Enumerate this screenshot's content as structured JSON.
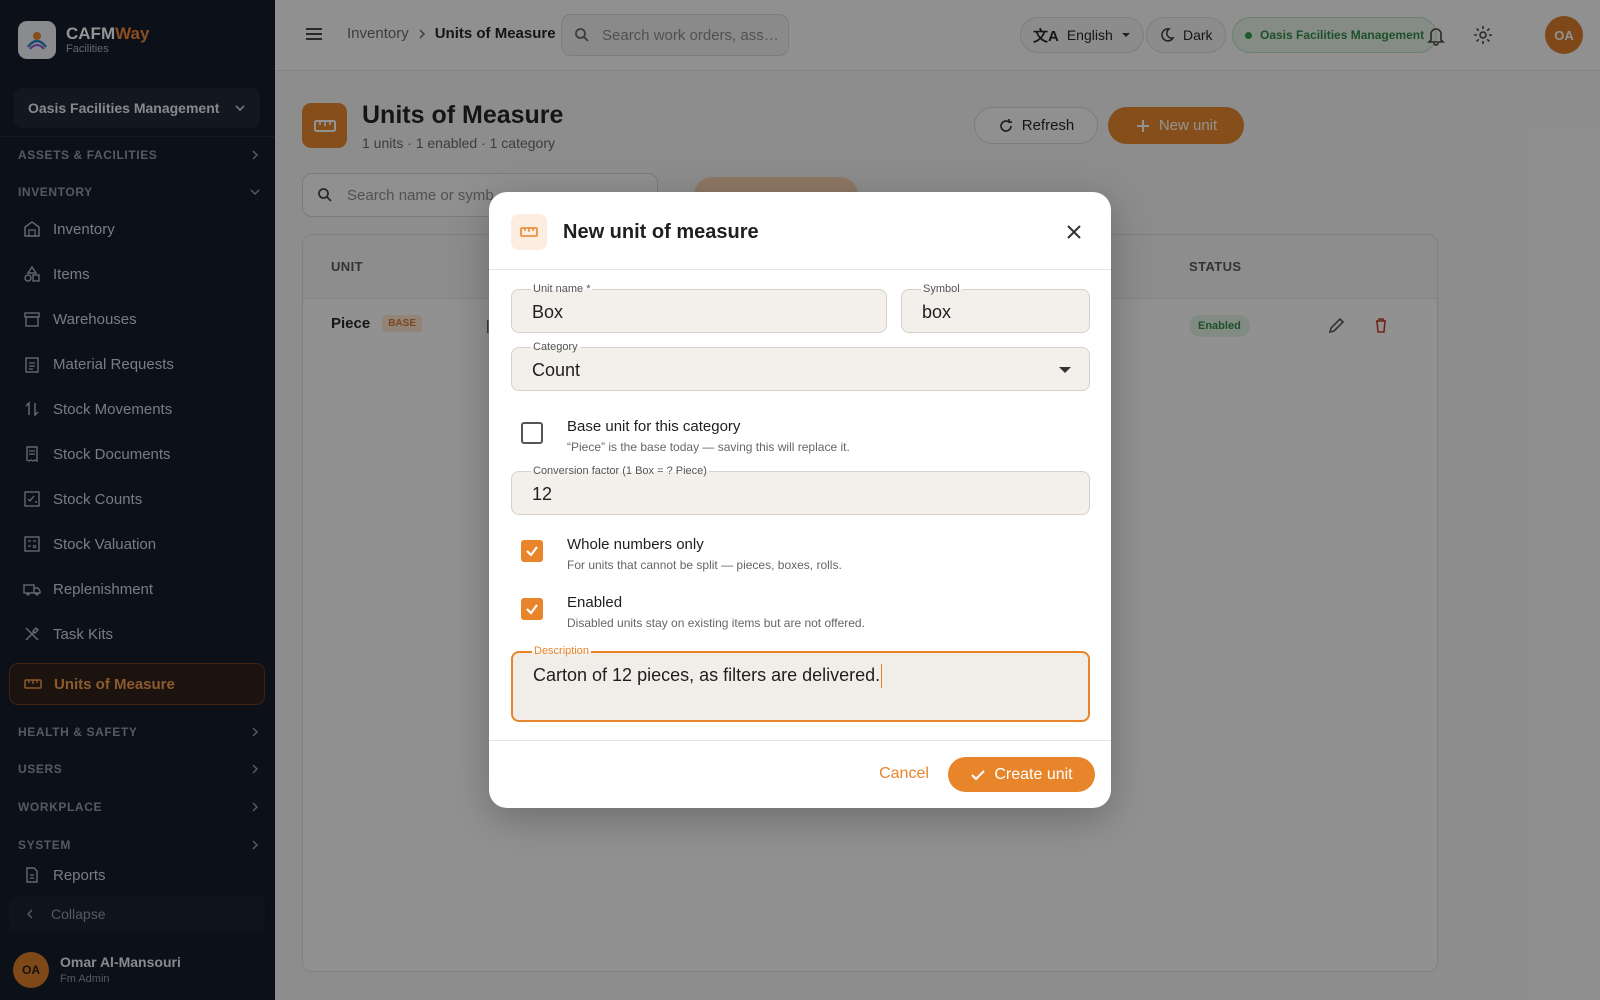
{
  "brand": {
    "name_part1": "CAFM",
    "name_part2": "Way",
    "subtitle": "Facilities"
  },
  "sidebar": {
    "org_select": "Oasis Facilities Management",
    "sections": {
      "assets": "ASSETS & FACILITIES",
      "inventory": "INVENTORY",
      "health": "HEALTH & SAFETY",
      "users": "USERS",
      "workplace": "WORKPLACE",
      "system": "SYSTEM"
    },
    "items": [
      {
        "label": "Inventory",
        "icon": "warehouse-icon"
      },
      {
        "label": "Items",
        "icon": "shapes-icon"
      },
      {
        "label": "Warehouses",
        "icon": "store-icon"
      },
      {
        "label": "Material Requests",
        "icon": "clipboard-icon"
      },
      {
        "label": "Stock Movements",
        "icon": "swap-vertical-icon"
      },
      {
        "label": "Stock Documents",
        "icon": "receipt-icon"
      },
      {
        "label": "Stock Counts",
        "icon": "checklist-icon"
      },
      {
        "label": "Stock Valuation",
        "icon": "calculator-icon"
      },
      {
        "label": "Replenishment",
        "icon": "truck-icon"
      },
      {
        "label": "Task Kits",
        "icon": "tools-icon"
      },
      {
        "label": "Units of Measure",
        "icon": "ruler-icon",
        "active": true
      }
    ],
    "reports": "Reports",
    "collapse": "Collapse",
    "user": {
      "initials": "OA",
      "name": "Omar Al-Mansouri",
      "role": "Fm Admin"
    }
  },
  "topbar": {
    "breadcrumb_parent": "Inventory",
    "breadcrumb_current": "Units of Measure",
    "search_placeholder": "Search work orders, ass…",
    "language": "English",
    "theme": "Dark",
    "org": "Oasis Facilities Management",
    "avatar": "OA"
  },
  "page": {
    "title": "Units of Measure",
    "subtitle": "1 units · 1 enabled · 1 category",
    "refresh_label": "Refresh",
    "new_label": "New unit",
    "search_placeholder": "Search name or symb",
    "columns": {
      "unit": "UNIT",
      "status": "STATUS"
    },
    "rows": [
      {
        "unit": "Piece",
        "base_badge": "BASE",
        "status": "Enabled"
      }
    ]
  },
  "modal": {
    "title": "New unit of measure",
    "unit_name_label": "Unit name *",
    "unit_name_value": "Box",
    "symbol_label": "Symbol",
    "symbol_value": "box",
    "category_label": "Category",
    "category_value": "Count",
    "base_unit_label": "Base unit for this category",
    "base_unit_help": "“Piece” is the base today — saving this will replace it.",
    "base_unit_checked": false,
    "conversion_label": "Conversion factor (1 Box = ? Piece)",
    "conversion_value": "12",
    "whole_numbers_label": "Whole numbers only",
    "whole_numbers_help": "For units that cannot be split — pieces, boxes, rolls.",
    "whole_numbers_checked": true,
    "enabled_label": "Enabled",
    "enabled_help": "Disabled units stay on existing items but are not offered.",
    "enabled_checked": true,
    "description_label": "Description",
    "description_value": "Carton of 12 pieces, as filters are delivered.",
    "cancel_label": "Cancel",
    "create_label": "Create unit"
  },
  "colors": {
    "accent": "#e8852a",
    "sidebar_bg": "#0f1724",
    "success": "#2f8a45"
  }
}
